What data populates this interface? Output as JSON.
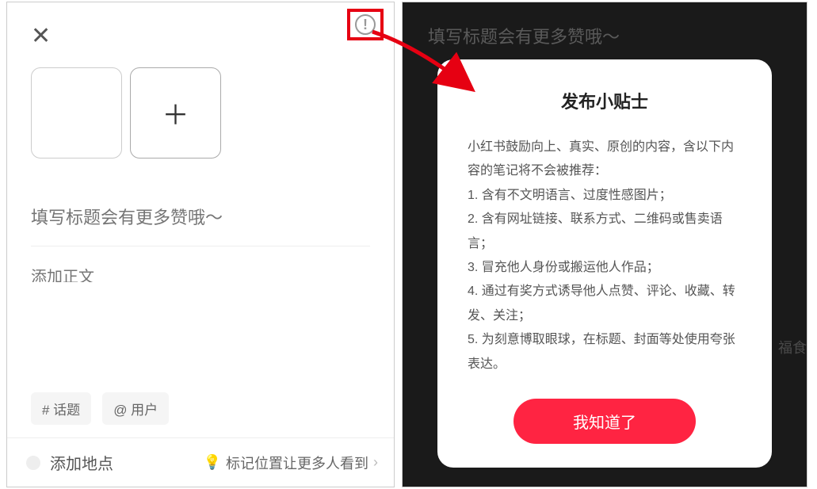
{
  "left": {
    "title_placeholder": "填写标题会有更多赞哦～",
    "content_placeholder": "添加正文",
    "chips": {
      "topic": "# 话题",
      "mention": "@ 用户"
    },
    "location_label": "添加地点",
    "location_hint": "标记位置让更多人看到"
  },
  "right": {
    "bg_title": "填写标题会有更多赞哦～",
    "side_fragment": "福食",
    "modal": {
      "title": "发布小贴士",
      "intro": "小红书鼓励向上、真实、原创的内容，含以下内容的笔记将不会被推荐：",
      "rules": [
        "1. 含有不文明语言、过度性感图片；",
        "2. 含有网址链接、联系方式、二维码或售卖语言；",
        "3. 冒充他人身份或搬运他人作品；",
        "4. 通过有奖方式诱导他人点赞、评论、收藏、转发、关注；",
        "5. 为刻意博取眼球，在标题、封面等处使用夸张表达。"
      ],
      "button": "我知道了"
    }
  },
  "colors": {
    "accent": "#ff2442",
    "annotation": "#e60012"
  }
}
